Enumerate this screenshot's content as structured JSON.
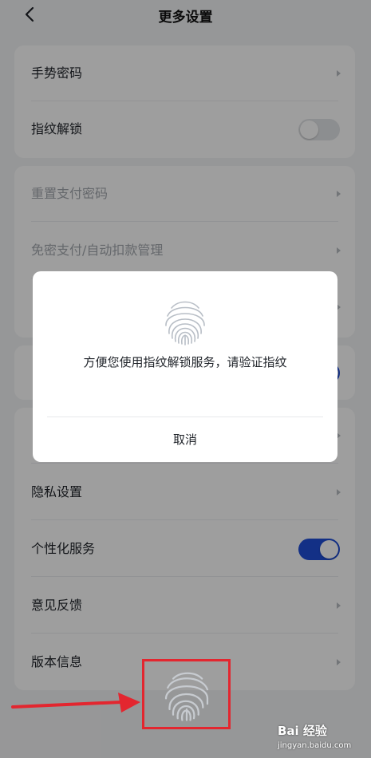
{
  "header": {
    "title": "更多设置"
  },
  "group1": [
    {
      "label": "手势密码",
      "type": "chevron"
    },
    {
      "label": "指纹解锁",
      "type": "toggle",
      "on": false
    }
  ],
  "group2": [
    {
      "label": "重置支付密码",
      "type": "chevron",
      "disabled": true
    },
    {
      "label": "免密支付/自动扣款管理",
      "type": "chevron",
      "disabled": true
    }
  ],
  "group4": [
    {
      "label": "隐私设置",
      "type": "chevron"
    },
    {
      "label": "个性化服务",
      "type": "toggle",
      "on": true
    },
    {
      "label": "意见反馈",
      "type": "chevron"
    },
    {
      "label": "版本信息",
      "type": "chevron"
    }
  ],
  "dialog": {
    "message": "方便您使用指纹解锁服务，请验证指纹",
    "cancel_label": "取消"
  },
  "watermark": {
    "logo": "Bai 经验",
    "url": "jingyan.baidu.com"
  },
  "colors": {
    "accent": "#1f4ed8",
    "highlight": "#e3262f"
  }
}
